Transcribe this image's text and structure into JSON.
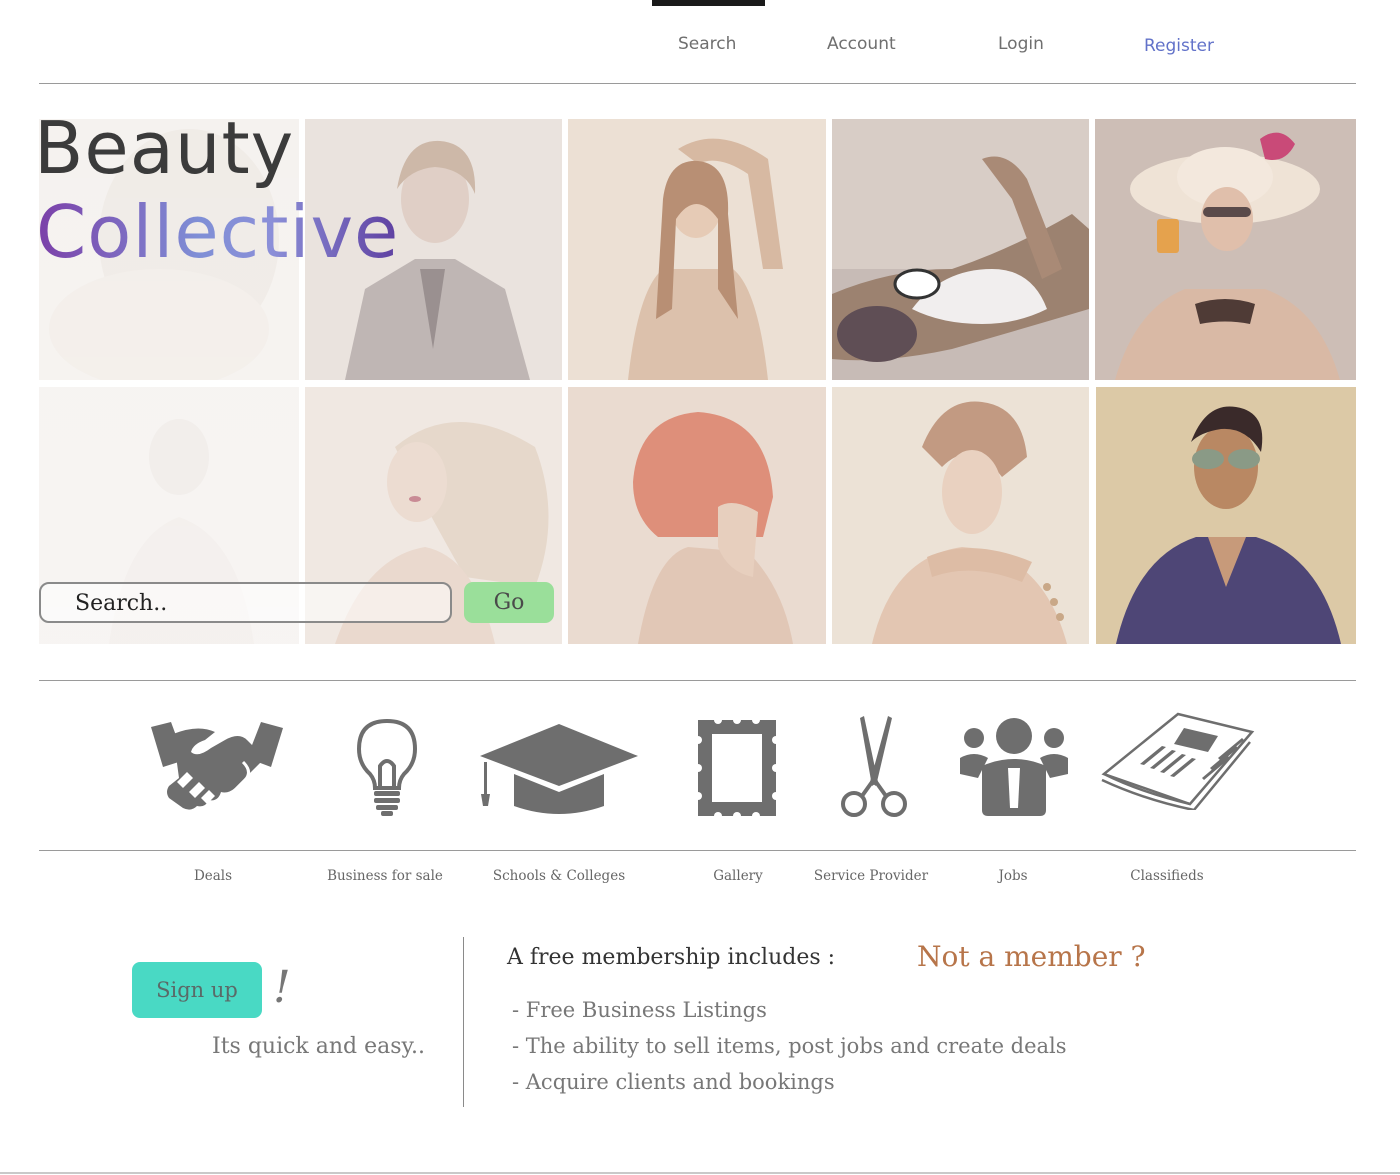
{
  "nav": {
    "items": [
      {
        "label": "Search",
        "active": true
      },
      {
        "label": "Account"
      },
      {
        "label": "Login"
      },
      {
        "label": "Register",
        "color": "#6272c9"
      }
    ]
  },
  "brand": {
    "line1": "Beauty",
    "line2": "Collective"
  },
  "hero": {
    "photos": [
      "woman-faded",
      "man-in-suit",
      "woman-arm-raised",
      "woman-sunbathing-sunglasses",
      "woman-sunhat-drink",
      "woman-faded-2",
      "woman-blonde-hair",
      "woman-red-bob-hair",
      "woman-pearls",
      "man-sunglasses"
    ]
  },
  "search": {
    "placeholder": "Search..",
    "go_label": "Go"
  },
  "categories": [
    {
      "label": "Deals",
      "icon": "handshake-icon"
    },
    {
      "label": "Business for sale",
      "icon": "lightbulb-icon"
    },
    {
      "label": "Schools & Colleges",
      "icon": "graduation-cap-icon"
    },
    {
      "label": "Gallery",
      "icon": "picture-frame-icon"
    },
    {
      "label": "Service Provider",
      "icon": "scissors-icon"
    },
    {
      "label": "Jobs",
      "icon": "people-icon"
    },
    {
      "label": "Classifieds",
      "icon": "newspaper-icon"
    }
  ],
  "signup": {
    "button_label": "Sign up",
    "exclaim": "!",
    "tagline": "Its quick and easy.."
  },
  "membership": {
    "title": "A free membership includes :",
    "not_member": "Not a member ?",
    "benefits": [
      "- Free Business Listings",
      "- The ability to sell items, post jobs and create deals",
      "- Acquire clients and bookings"
    ]
  },
  "colors": {
    "accent_register": "#6272c9",
    "go_button": "#9adf9a",
    "signup_button": "#49d9c4",
    "not_member": "#b7754a",
    "icon_gray": "#6e6e6e"
  }
}
